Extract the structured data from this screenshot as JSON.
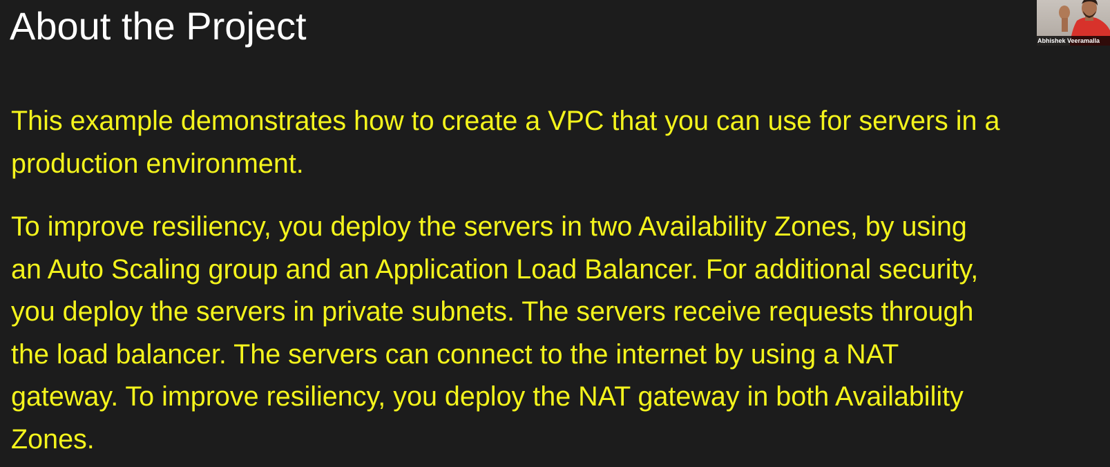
{
  "slide": {
    "title": "About the Project",
    "paragraphs": [
      {
        "lines": [
          "This example demonstrates how to create a VPC that you can use for servers in a",
          "production environment."
        ]
      },
      {
        "lines": [
          "To improve resiliency, you deploy the servers in two Availability Zones, by using",
          "an Auto Scaling group and an Application Load Balancer. For additional security,",
          "you deploy the servers in private subnets. The servers receive requests through",
          "the load balancer. The servers can connect to the internet by using a NAT",
          "gateway. To improve resiliency, you deploy the NAT gateway in both Availability",
          "Zones."
        ]
      }
    ]
  },
  "webcam": {
    "participant_name": "Abhishek Veeramalla"
  },
  "colors": {
    "background": "#1c1c1c",
    "title": "#ffffff",
    "body_text": "#f4f41c"
  }
}
